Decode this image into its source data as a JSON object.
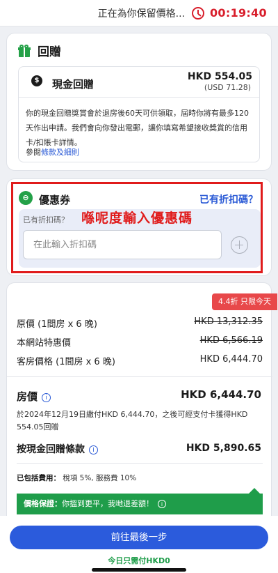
{
  "topbar": {
    "message": "正在為你保留價格...",
    "timer": "00:19:40"
  },
  "rewards": {
    "title": "回贈",
    "cash_label": "現金回贈",
    "amount": "HKD 554.05",
    "amount_usd": "(USD 71.28)",
    "description": "你的現金回贈獎賞會於退房後60天可供領取，屆時你將有最多120天作出申請。我們會向你發出電郵，讓你填寫希望接收獎賞的信用卡/扣賬卡詳情。",
    "terms_prefix": "參閱",
    "terms_link": "條款及細則"
  },
  "coupon": {
    "title": "優惠券",
    "has_code_link": "已有折扣碼？",
    "annotation": "喺呢度輸入優惠碼",
    "code_label": "已有折扣碼？",
    "code_placeholder": "在此輸入折扣碼",
    "code_value": ""
  },
  "price": {
    "badge": "4.4折 只限今天",
    "rows": [
      {
        "label": "原價 (1間房 x 6 晚)",
        "value": "HKD 13,312.35"
      },
      {
        "label": "本網站特惠價",
        "value": "HKD 6,566.19"
      },
      {
        "label": "客房價格 (1間房 x 6 晚)",
        "value": "HKD 6,444.70"
      }
    ],
    "room_price_label": "房價",
    "room_price_value": "HKD 6,444.70",
    "room_note": "於2024年12月19日繳付HKD 6,444.70，之後可經支付卡獲得HKD 554.05回贈",
    "cash_terms_label": "按現金回贈條款",
    "cash_terms_value": "HKD 5,890.65",
    "included_label": "已包括費用：",
    "included_value": "稅項 5%, 服務費 10%",
    "guarantee_label": "價格保證：",
    "guarantee_text": "你搵到更平，我哋退差額！"
  },
  "footer": {
    "next_button": "前往最後一步",
    "pay_today": "今日只需付HKD0"
  }
}
